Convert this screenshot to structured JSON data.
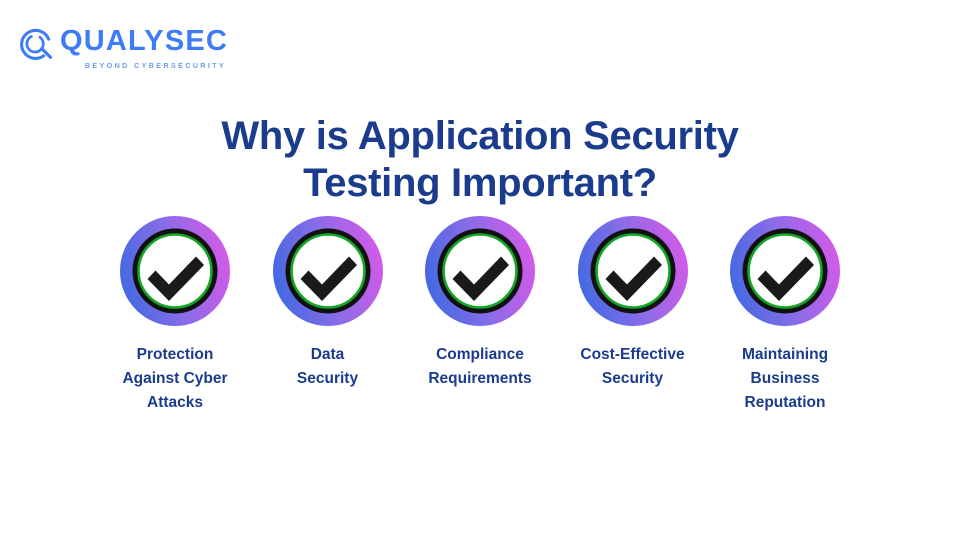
{
  "brand": {
    "logo_icon": "qualysec-magnifier-q-icon",
    "wordmark": "QUALYSEC",
    "tagline": "BEYOND CYBERSECURITY",
    "wordmark_color": "#3d7bf7",
    "tagline_color": "#6f9bf0"
  },
  "heading": {
    "line1": "Why is Application Security",
    "line2": "Testing Important?",
    "color": "#1b3c8c"
  },
  "colors": {
    "background": "#ffffff",
    "gradient_start": "#4169e1",
    "gradient_mid": "#9a6ae8",
    "gradient_end": "#d45ae8",
    "ring_green": "#12a825",
    "ring_black": "#111111",
    "check_black": "#1a1a1a",
    "inner_white": "#ffffff"
  },
  "benefits": [
    {
      "icon": "green-check-circle-icon",
      "label": "Protection\nAgainst Cyber\nAttacks"
    },
    {
      "icon": "green-check-circle-icon",
      "label": "Data\nSecurity"
    },
    {
      "icon": "green-check-circle-icon",
      "label": "Compliance\nRequirements"
    },
    {
      "icon": "green-check-circle-icon",
      "label": "Cost-Effective\nSecurity"
    },
    {
      "icon": "green-check-circle-icon",
      "label": "Maintaining\nBusiness\nReputation"
    }
  ]
}
